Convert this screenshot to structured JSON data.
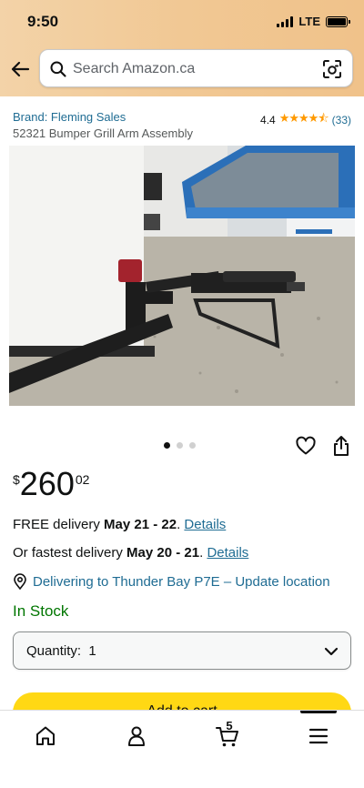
{
  "status_bar": {
    "time": "9:50",
    "network": "LTE"
  },
  "search": {
    "placeholder": "Search Amazon.ca"
  },
  "product": {
    "brand": "Brand: Fleming Sales",
    "title": "52321 Bumper Grill Arm Assembly",
    "rating": "4.4",
    "stars": "★★★★⯪",
    "review_count": "(33)",
    "image_count": 3,
    "active_image": 1
  },
  "price": {
    "currency": "$",
    "whole": "260",
    "fraction": "02"
  },
  "delivery": {
    "free_prefix": "FREE delivery ",
    "free_dates": "May 21 - 22",
    "free_suffix": ". ",
    "fastest_prefix": "Or fastest delivery ",
    "fastest_dates": "May 20 - 21",
    "fastest_suffix": ". ",
    "details_label": "Details"
  },
  "location": {
    "text": "Delivering to Thunder Bay P7E – Update location"
  },
  "stock": {
    "status": "In Stock"
  },
  "quantity": {
    "label": "Quantity:",
    "value": "1"
  },
  "buy": {
    "add_to_cart": "Add to cart"
  },
  "tabbar": {
    "cart_count": "5"
  },
  "colors": {
    "link": "#1f6c93",
    "in_stock": "#007600",
    "add_to_cart": "#ffd814",
    "stars": "#ff9900",
    "header_gradient_start": "#f3d3a8",
    "header_gradient_end": "#f0c28a"
  }
}
